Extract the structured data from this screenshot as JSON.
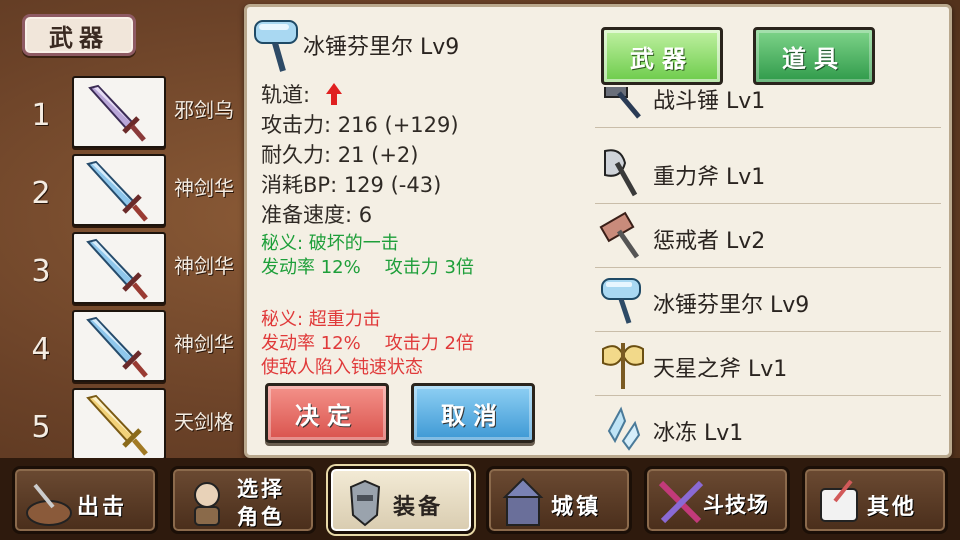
{
  "weapon_tab_label": "武器",
  "slots": [
    {
      "num": "1",
      "name": "邪剑乌",
      "icon": "purple-sword-icon"
    },
    {
      "num": "2",
      "name": "神剑华",
      "icon": "blue-sword-icon"
    },
    {
      "num": "3",
      "name": "神剑华",
      "icon": "blue-sword-icon"
    },
    {
      "num": "4",
      "name": "神剑华",
      "icon": "blue-sword-icon"
    },
    {
      "num": "5",
      "name": "天剑格",
      "icon": "gold-sword-icon"
    }
  ],
  "detail": {
    "title": "冰锤芬里尔 Lv9",
    "icon": "ice-hammer-icon",
    "trajectory_label": "轨道:",
    "trajectory_icon": "up-arrow-icon",
    "attack": "攻击力: 216 (+129)",
    "durability": "耐久力: 21 (+2)",
    "bp_cost": "消耗BP: 129 (-43)",
    "ready_speed": "准备速度: 6",
    "skill1": {
      "name": "秘义: 破坏的一击",
      "rate": "发动率 12%",
      "power": "攻击力 3倍",
      "color": "#1e9f3a"
    },
    "skill2": {
      "name": "秘义: 超重力击",
      "rate": "发动率 12%",
      "power": "攻击力 2倍",
      "effect": "使敌人陷入钝速状态",
      "color": "#e03a3a"
    }
  },
  "buttons": {
    "confirm": "决定",
    "cancel": "取消"
  },
  "tabs": {
    "weapons": "武器",
    "items": "道具"
  },
  "list": [
    {
      "label": "战斗锤 Lv1",
      "icon": "war-hammer-icon"
    },
    {
      "label": "重力斧 Lv1",
      "icon": "gravity-axe-icon"
    },
    {
      "label": "惩戒者 Lv2",
      "icon": "punisher-hammer-icon"
    },
    {
      "label": "冰锤芬里尔 Lv9",
      "icon": "ice-hammer-icon"
    },
    {
      "label": "天星之斧 Lv1",
      "icon": "star-axe-icon"
    },
    {
      "label": "冰冻 Lv1",
      "icon": "ice-shard-icon"
    }
  ],
  "nav": [
    {
      "label": "出击",
      "icon": "sortie-icon",
      "active": false
    },
    {
      "label": "选择\n角色",
      "icon": "character-icon",
      "active": false
    },
    {
      "label": "装备",
      "icon": "armor-icon",
      "active": true
    },
    {
      "label": "城镇",
      "icon": "castle-icon",
      "active": false
    },
    {
      "label": "斗技场",
      "icon": "arena-swords-icon",
      "active": false
    },
    {
      "label": "其他",
      "icon": "other-scroll-icon",
      "active": false
    }
  ]
}
